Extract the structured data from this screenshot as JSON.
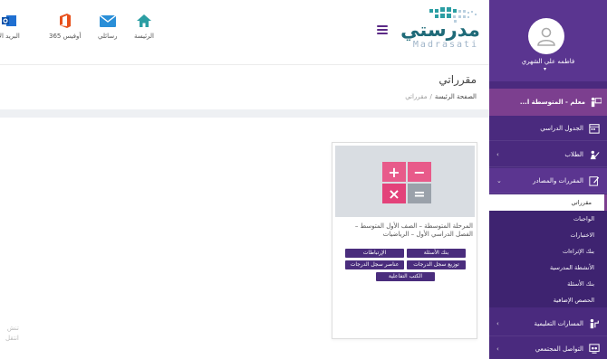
{
  "header": {
    "quick_links": [
      {
        "label": "الرئيسة",
        "icon": "home-icon",
        "color": "#2b9ea3"
      },
      {
        "label": "رسائلي",
        "icon": "envelope-icon",
        "color": "#2a8fd8"
      },
      {
        "label": "أوفيس 365",
        "icon": "office-icon",
        "color": "#e8501b"
      },
      {
        "label": "البريد الإ",
        "icon": "outlook-icon",
        "color": "#1f6fd1"
      }
    ],
    "logo_ar": "مدرستي",
    "logo_en": "Madrasati"
  },
  "page": {
    "title": "مقرراتي",
    "breadcrumb": {
      "home": "الصفحة الرئيسة",
      "separator": "/",
      "current": "مقرراتي"
    }
  },
  "course_card": {
    "title": "المرحلة المتوسطة – الصف الأول المتوسط – الفصل الدراسي الأول – الرياضيات",
    "buttons": [
      "الإرتباطات",
      "بنك الأسئلة",
      "عناصر سجل الدرجات",
      "توزيع سجل الدرجات",
      "الكتب التفاعلية"
    ]
  },
  "partial_text": [
    "تنش",
    "انتقل"
  ],
  "sidebar": {
    "user_name": "فاطمه علي الشهري",
    "role": "معلم - المتوسطة ا...",
    "items": [
      {
        "label": "الجدول الدراسي",
        "icon": "calendar-icon",
        "chevron": false
      },
      {
        "label": "الطلاب",
        "icon": "students-icon",
        "chevron": true
      },
      {
        "label": "المقررات والمصادر",
        "icon": "edit-icon",
        "chevron": true
      }
    ],
    "subitems": [
      {
        "label": "مقرراتي",
        "active": true
      },
      {
        "label": "الواجبات",
        "active": false
      },
      {
        "label": "الاختبارات",
        "active": false
      },
      {
        "label": "بنك الإثراءات",
        "active": false
      },
      {
        "label": "الأنشطة المدرسية",
        "active": false
      },
      {
        "label": "بنك الأسئلة",
        "active": false
      },
      {
        "label": "الحصص الإضافية",
        "active": false
      }
    ],
    "bottom_items": [
      {
        "label": "المسارات التعليمية",
        "icon": "paths-icon",
        "chevron": true
      },
      {
        "label": "التواصل المجتمعي",
        "icon": "community-icon",
        "chevron": true
      }
    ],
    "colors": {
      "bg": "#4a2a7e",
      "role_bg": "#7c3f8f"
    }
  }
}
